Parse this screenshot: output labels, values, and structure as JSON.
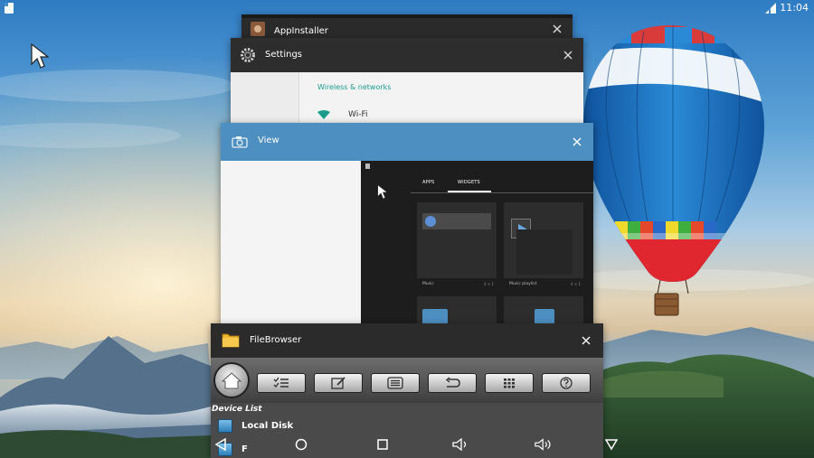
{
  "status_bar": {
    "time": "11:04"
  },
  "recents": {
    "app_installer": {
      "title": "AppInstaller"
    },
    "settings": {
      "title": "Settings",
      "section": "Wireless & networks",
      "item": "Wi-Fi"
    },
    "view": {
      "title": "View",
      "tabs": [
        "APPS",
        "WIDGETS"
      ],
      "widgets": [
        {
          "label": "Music",
          "meta": "4 × 1"
        },
        {
          "label": "Music playlist",
          "meta": "4 × 1"
        }
      ]
    },
    "file_browser": {
      "title": "FileBrowser",
      "device_list_label": "Device List",
      "devices": [
        "Local Disk",
        "F"
      ]
    }
  }
}
